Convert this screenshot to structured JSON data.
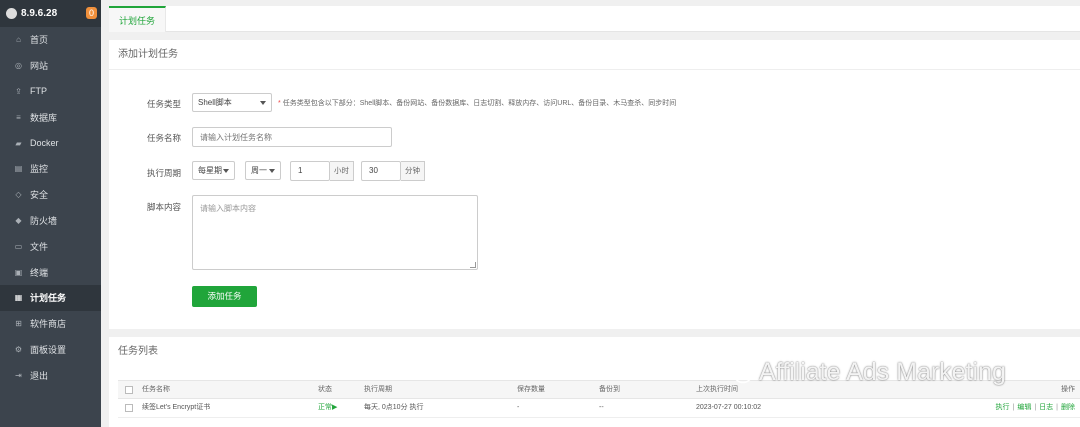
{
  "sidebar": {
    "version": "8.9.6.28",
    "badge": "0",
    "items": [
      {
        "label": "首页",
        "icon": "home-icon",
        "glyph": "⌂"
      },
      {
        "label": "网站",
        "icon": "globe-icon",
        "glyph": "◎"
      },
      {
        "label": "FTP",
        "icon": "ftp-icon",
        "glyph": "⇪"
      },
      {
        "label": "数据库",
        "icon": "database-icon",
        "glyph": "≡"
      },
      {
        "label": "Docker",
        "icon": "docker-icon",
        "glyph": "▰"
      },
      {
        "label": "监控",
        "icon": "monitor-icon",
        "glyph": "▤"
      },
      {
        "label": "安全",
        "icon": "shield-icon",
        "glyph": "◇"
      },
      {
        "label": "防火墙",
        "icon": "firewall-icon",
        "glyph": "◆"
      },
      {
        "label": "文件",
        "icon": "folder-icon",
        "glyph": "▭"
      },
      {
        "label": "终端",
        "icon": "terminal-icon",
        "glyph": "▣"
      },
      {
        "label": "计划任务",
        "icon": "cron-icon",
        "glyph": "▦"
      },
      {
        "label": "软件商店",
        "icon": "store-icon",
        "glyph": "⊞"
      },
      {
        "label": "面板设置",
        "icon": "gear-icon",
        "glyph": "⚙"
      },
      {
        "label": "退出",
        "icon": "logout-icon",
        "glyph": "⇥"
      }
    ],
    "active_index": 10
  },
  "tabs": {
    "active": "计划任务"
  },
  "form": {
    "title": "添加计划任务",
    "type_label": "任务类型",
    "type_value": "Shell脚本",
    "type_hint": "任务类型包含以下部分：Shell脚本、备份网站、备份数据库、日志切割、释放内存、访问URL、备份目录、木马查杀、同步时间",
    "name_label": "任务名称",
    "name_placeholder": "请输入计划任务名称",
    "cycle_label": "执行周期",
    "cycle_value": "每星期",
    "weekday_value": "周一",
    "hour_value": "1",
    "hour_unit": "小时",
    "minute_value": "30",
    "minute_unit": "分钟",
    "script_label": "脚本内容",
    "script_placeholder": "请输入脚本内容",
    "submit": "添加任务"
  },
  "list": {
    "title": "任务列表",
    "columns": {
      "name": "任务名称",
      "status": "状态",
      "cycle": "执行周期",
      "keep": "保存数量",
      "backup": "备份到",
      "last_run": "上次执行时间",
      "ops": "操作"
    },
    "rows": [
      {
        "name": "续签Let's Encrypt证书",
        "status": "正常▶",
        "cycle": "每天, 0点10分 执行",
        "keep": "-",
        "backup": "--",
        "last_run": "2023-07-27 00:10:02",
        "op_run": "执行",
        "op_edit": "编辑",
        "op_log": "日志",
        "op_delete": "删除",
        "op_sep": "|"
      }
    ]
  },
  "watermark": {
    "text": "Affiliate Ads Marketing",
    "icon": "wechat-icon"
  },
  "colors": {
    "accent": "#20a53a",
    "sidebar": "#3c444d",
    "badge": "#f0903c"
  }
}
